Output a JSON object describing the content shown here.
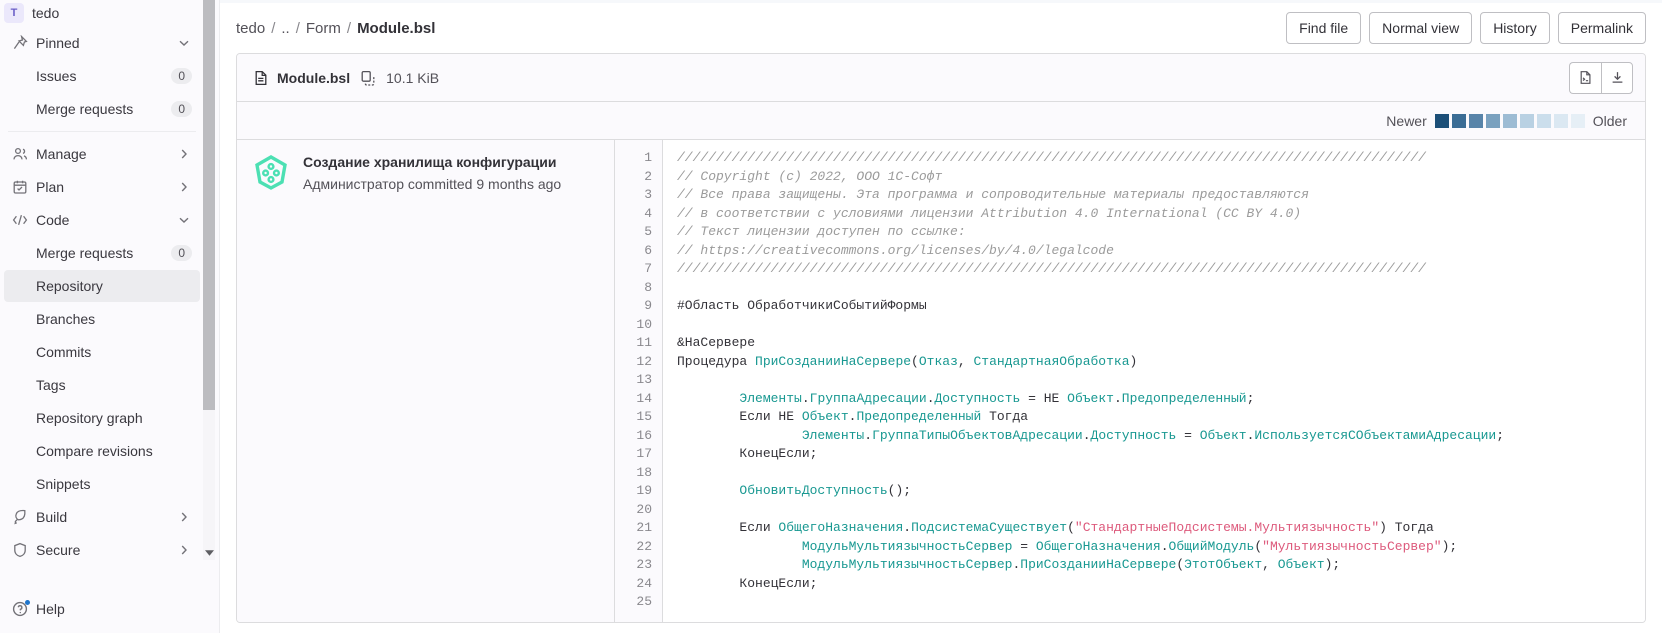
{
  "sidebar": {
    "context": {
      "avatar_letter": "T",
      "name": "tedo"
    },
    "items": [
      {
        "name": "pinned",
        "label": "Pinned",
        "icon": "pin-icon",
        "chevron": "down",
        "level": 0
      },
      {
        "name": "issues",
        "label": "Issues",
        "count": "0",
        "level": 1
      },
      {
        "name": "merge-requests-pinned",
        "label": "Merge requests",
        "count": "0",
        "level": 1
      },
      {
        "name": "manage",
        "label": "Manage",
        "icon": "users-icon",
        "chevron": "right",
        "level": 0,
        "sep_before": true
      },
      {
        "name": "plan",
        "label": "Plan",
        "icon": "calendar-icon",
        "chevron": "right",
        "level": 0
      },
      {
        "name": "code",
        "label": "Code",
        "icon": "code-icon",
        "chevron": "down",
        "level": 0
      },
      {
        "name": "merge-requests",
        "label": "Merge requests",
        "count": "0",
        "level": 1
      },
      {
        "name": "repository",
        "label": "Repository",
        "level": 1,
        "active": true
      },
      {
        "name": "branches",
        "label": "Branches",
        "level": 1
      },
      {
        "name": "commits",
        "label": "Commits",
        "level": 1
      },
      {
        "name": "tags",
        "label": "Tags",
        "level": 1
      },
      {
        "name": "repository-graph",
        "label": "Repository graph",
        "level": 1
      },
      {
        "name": "compare-revisions",
        "label": "Compare revisions",
        "level": 1
      },
      {
        "name": "snippets",
        "label": "Snippets",
        "level": 1
      },
      {
        "name": "build",
        "label": "Build",
        "icon": "rocket-icon",
        "chevron": "right",
        "level": 0
      },
      {
        "name": "secure",
        "label": "Secure",
        "icon": "shield-icon",
        "chevron": "right",
        "level": 0
      }
    ],
    "help": {
      "label": "Help",
      "icon": "question-circle-icon"
    }
  },
  "breadcrumb": {
    "items": [
      "tedo",
      "..",
      "Form"
    ],
    "current": "Module.bsl",
    "separator": "/"
  },
  "page_actions": [
    {
      "name": "find-file",
      "label": "Find file"
    },
    {
      "name": "normal-view",
      "label": "Normal view"
    },
    {
      "name": "history",
      "label": "History"
    },
    {
      "name": "permalink",
      "label": "Permalink"
    }
  ],
  "file_header": {
    "file_icon": "document-icon",
    "name": "Module.bsl",
    "copy_icon": "copy-icon",
    "size": "10.1 KiB",
    "actions": [
      {
        "name": "open-raw-button",
        "icon": "code-file-icon"
      },
      {
        "name": "download-button",
        "icon": "download-icon"
      }
    ]
  },
  "blame_legend": {
    "newer_label": "Newer",
    "older_label": "Older",
    "colors": [
      "#1c4f78",
      "#3b6d95",
      "#5884a9",
      "#7aa1bf",
      "#9dbcd4",
      "#b9d1e3",
      "#cbdeec",
      "#dbe8f2",
      "#e6eff6"
    ]
  },
  "blame": {
    "commit": {
      "title": "Создание хранилища конфигурации",
      "meta": "Администратор committed 9 months ago",
      "avatar": "project-identicon"
    },
    "line_numbers": [
      "1",
      "2",
      "3",
      "4",
      "5",
      "6",
      "7",
      "8",
      "9",
      "10",
      "11",
      "12",
      "13",
      "14",
      "15",
      "16",
      "17",
      "18",
      "19",
      "20",
      "21",
      "22",
      "23",
      "24",
      "25"
    ]
  },
  "code": {
    "language": "bsl",
    "lines": [
      [
        {
          "t": "cm",
          "s": "////////////////////////////////////////////////////////////////////////////////////////////////"
        }
      ],
      [
        {
          "t": "cm",
          "s": "// Copyright (c) 2022, ООО 1С-Софт"
        }
      ],
      [
        {
          "t": "cm",
          "s": "// Все права защищены. Эта программа и сопроводительные материалы предоставляются"
        }
      ],
      [
        {
          "t": "cm",
          "s": "// в соответствии с условиями лицензии Attribution 4.0 International (CC BY 4.0)"
        }
      ],
      [
        {
          "t": "cm",
          "s": "// Текст лицензии доступен по ссылке:"
        }
      ],
      [
        {
          "t": "cm",
          "s": "// https://creativecommons.org/licenses/by/4.0/legalcode"
        }
      ],
      [
        {
          "t": "cm",
          "s": "////////////////////////////////////////////////////////////////////////////////////////////////"
        }
      ],
      [],
      [
        {
          "t": "pl",
          "s": "#Область ОбработчикиСобытийФормы"
        }
      ],
      [],
      [
        {
          "t": "pl",
          "s": "&НаСервере"
        }
      ],
      [
        {
          "t": "pl",
          "s": "Процедура "
        },
        {
          "t": "id",
          "s": "ПриСозданииНаСервере"
        },
        {
          "t": "pl",
          "s": "("
        },
        {
          "t": "id",
          "s": "Отказ"
        },
        {
          "t": "pl",
          "s": ", "
        },
        {
          "t": "id",
          "s": "СтандартнаяОбработка"
        },
        {
          "t": "pl",
          "s": ")"
        }
      ],
      [],
      [
        {
          "t": "pl",
          "s": "\t"
        },
        {
          "t": "id",
          "s": "Элементы"
        },
        {
          "t": "pl",
          "s": "."
        },
        {
          "t": "id",
          "s": "ГруппаАдресации"
        },
        {
          "t": "pl",
          "s": "."
        },
        {
          "t": "id",
          "s": "Доступность"
        },
        {
          "t": "pl",
          "s": " = НЕ "
        },
        {
          "t": "id",
          "s": "Объект"
        },
        {
          "t": "pl",
          "s": "."
        },
        {
          "t": "id",
          "s": "Предопределенный"
        },
        {
          "t": "pl",
          "s": ";"
        }
      ],
      [
        {
          "t": "pl",
          "s": "\tЕсли НЕ "
        },
        {
          "t": "id",
          "s": "Объект"
        },
        {
          "t": "pl",
          "s": "."
        },
        {
          "t": "id",
          "s": "Предопределенный"
        },
        {
          "t": "pl",
          "s": " Тогда"
        }
      ],
      [
        {
          "t": "pl",
          "s": "\t\t"
        },
        {
          "t": "id",
          "s": "Элементы"
        },
        {
          "t": "pl",
          "s": "."
        },
        {
          "t": "id",
          "s": "ГруппаТипыОбъектовАдресации"
        },
        {
          "t": "pl",
          "s": "."
        },
        {
          "t": "id",
          "s": "Доступность"
        },
        {
          "t": "pl",
          "s": " = "
        },
        {
          "t": "id",
          "s": "Объект"
        },
        {
          "t": "pl",
          "s": "."
        },
        {
          "t": "id",
          "s": "ИспользуетсяСОбъектамиАдресации"
        },
        {
          "t": "pl",
          "s": ";"
        }
      ],
      [
        {
          "t": "pl",
          "s": "\tКонецЕсли;"
        }
      ],
      [],
      [
        {
          "t": "pl",
          "s": "\t"
        },
        {
          "t": "id",
          "s": "ОбновитьДоступность"
        },
        {
          "t": "pl",
          "s": "();"
        }
      ],
      [],
      [
        {
          "t": "pl",
          "s": "\tЕсли "
        },
        {
          "t": "id",
          "s": "ОбщегоНазначения"
        },
        {
          "t": "pl",
          "s": "."
        },
        {
          "t": "id",
          "s": "ПодсистемаСуществует"
        },
        {
          "t": "pl",
          "s": "("
        },
        {
          "t": "str",
          "s": "\"СтандартныеПодсистемы.Мультиязычность\""
        },
        {
          "t": "pl",
          "s": ") Тогда"
        }
      ],
      [
        {
          "t": "pl",
          "s": "\t\t"
        },
        {
          "t": "id",
          "s": "МодульМультиязычностьСервер"
        },
        {
          "t": "pl",
          "s": " = "
        },
        {
          "t": "id",
          "s": "ОбщегоНазначения"
        },
        {
          "t": "pl",
          "s": "."
        },
        {
          "t": "id",
          "s": "ОбщийМодуль"
        },
        {
          "t": "pl",
          "s": "("
        },
        {
          "t": "str",
          "s": "\"МультиязычностьСервер\""
        },
        {
          "t": "pl",
          "s": ");"
        }
      ],
      [
        {
          "t": "pl",
          "s": "\t\t"
        },
        {
          "t": "id",
          "s": "МодульМультиязычностьСервер"
        },
        {
          "t": "pl",
          "s": "."
        },
        {
          "t": "id",
          "s": "ПриСозданииНаСервере"
        },
        {
          "t": "pl",
          "s": "("
        },
        {
          "t": "id",
          "s": "ЭтотОбъект"
        },
        {
          "t": "pl",
          "s": ", "
        },
        {
          "t": "id",
          "s": "Объект"
        },
        {
          "t": "pl",
          "s": ");"
        }
      ],
      [
        {
          "t": "pl",
          "s": "\tКонецЕсли;"
        }
      ],
      []
    ]
  }
}
